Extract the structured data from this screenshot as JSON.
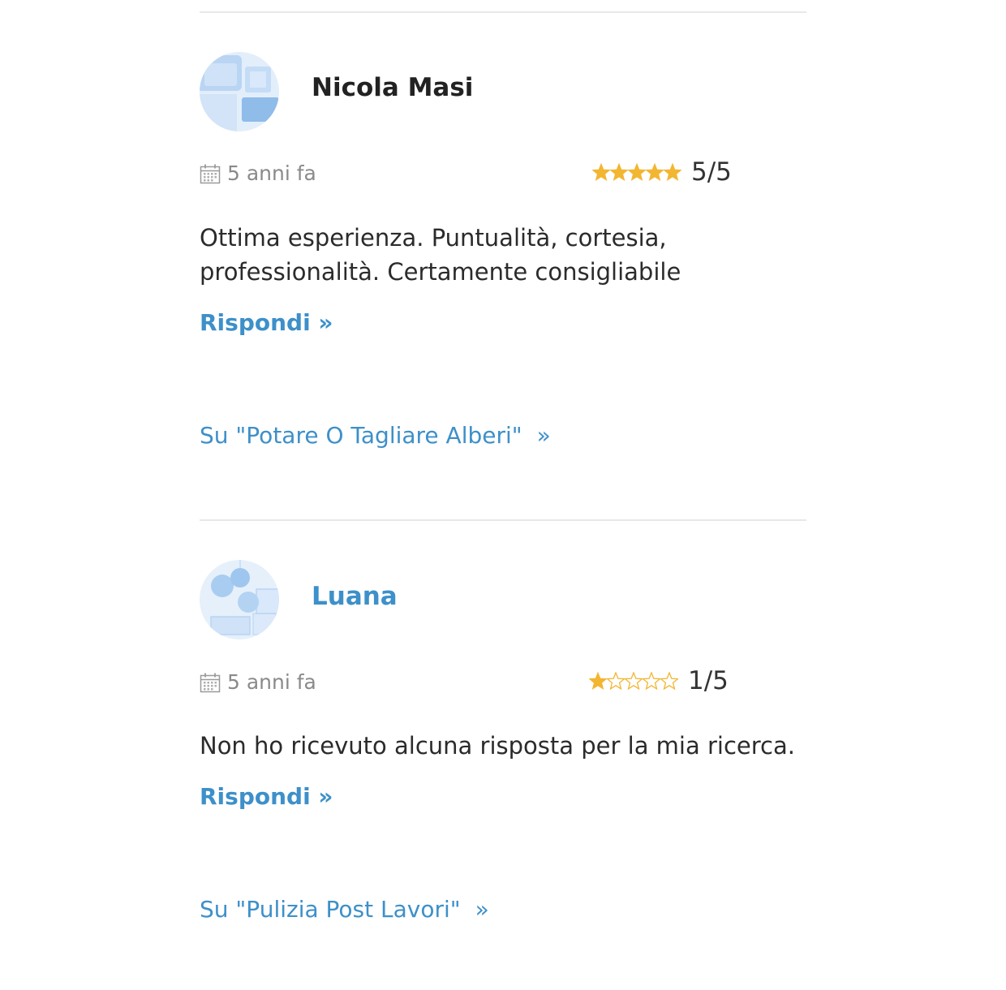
{
  "reviews": [
    {
      "author": "Nicola Masi",
      "author_is_link": false,
      "date_icon": "calendar-icon",
      "date": "5 anni fa",
      "rating": 5,
      "rating_max": 5,
      "score_text": "5/5",
      "text": "Ottima esperienza. Puntualità, cortesia, professionalità. Certamente consigliabile",
      "reply_label": "Rispondi »",
      "service_label": "Su \"Potare O Tagliare Alberi\"",
      "service_arrow": "»"
    },
    {
      "author": "Luana",
      "author_is_link": true,
      "date_icon": "calendar-icon",
      "date": "5 anni fa",
      "rating": 1,
      "rating_max": 5,
      "score_text": "1/5",
      "text": "Non ho ricevuto alcuna risposta per la mia ricerca.",
      "reply_label": "Rispondi »",
      "service_label": "Su \"Pulizia Post Lavori\"",
      "service_arrow": "»"
    }
  ],
  "colors": {
    "link": "#3d90c9",
    "star_filled": "#f2b632",
    "star_empty_outline": "#f2b632",
    "divider": "#e8e8e8",
    "muted": "#8a8a8a"
  }
}
